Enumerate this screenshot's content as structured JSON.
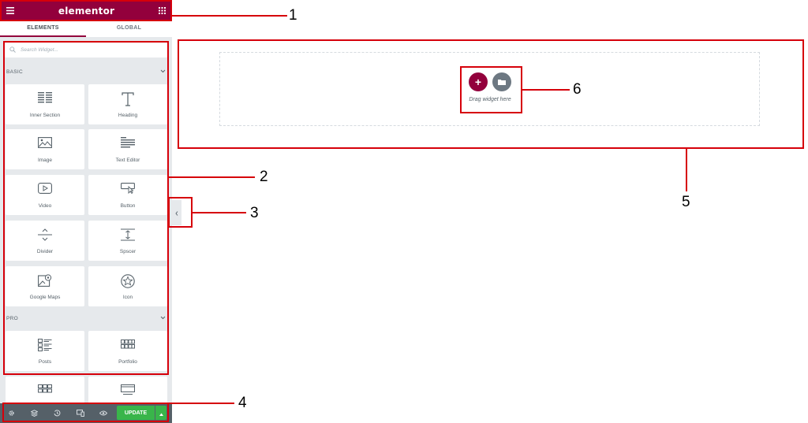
{
  "topbar": {
    "brand": "elementor",
    "menu_icon": "hamburger-icon",
    "grid_icon": "apps-grid-icon"
  },
  "tabs": [
    {
      "label": "ELEMENTS",
      "active": true
    },
    {
      "label": "GLOBAL",
      "active": false
    }
  ],
  "search": {
    "placeholder": "Search Widget..."
  },
  "categories": {
    "basic": "BASIC",
    "pro": "PRO"
  },
  "widgets": {
    "inner_section": "Inner Section",
    "heading": "Heading",
    "image": "Image",
    "text_editor": "Text Editor",
    "video": "Video",
    "button": "Button",
    "divider": "Divider",
    "spacer": "Spscer",
    "google_maps": "Google Maps",
    "icon": "Icon",
    "posts": "Posts",
    "portfolio": "Portfolio"
  },
  "footer": {
    "update_label": "UPDATE",
    "icons": [
      "settings-icon",
      "navigator-icon",
      "history-icon",
      "responsive-icon",
      "preview-icon"
    ]
  },
  "canvas": {
    "drop_text": "Drag widget here",
    "add_label": "+"
  },
  "callouts": [
    "1",
    "2",
    "3",
    "4",
    "5",
    "6"
  ],
  "colors": {
    "brand": "#93003c",
    "update": "#39b54a",
    "callout": "#d6000a",
    "panel": "#e6e9ec",
    "footer": "#556068"
  }
}
